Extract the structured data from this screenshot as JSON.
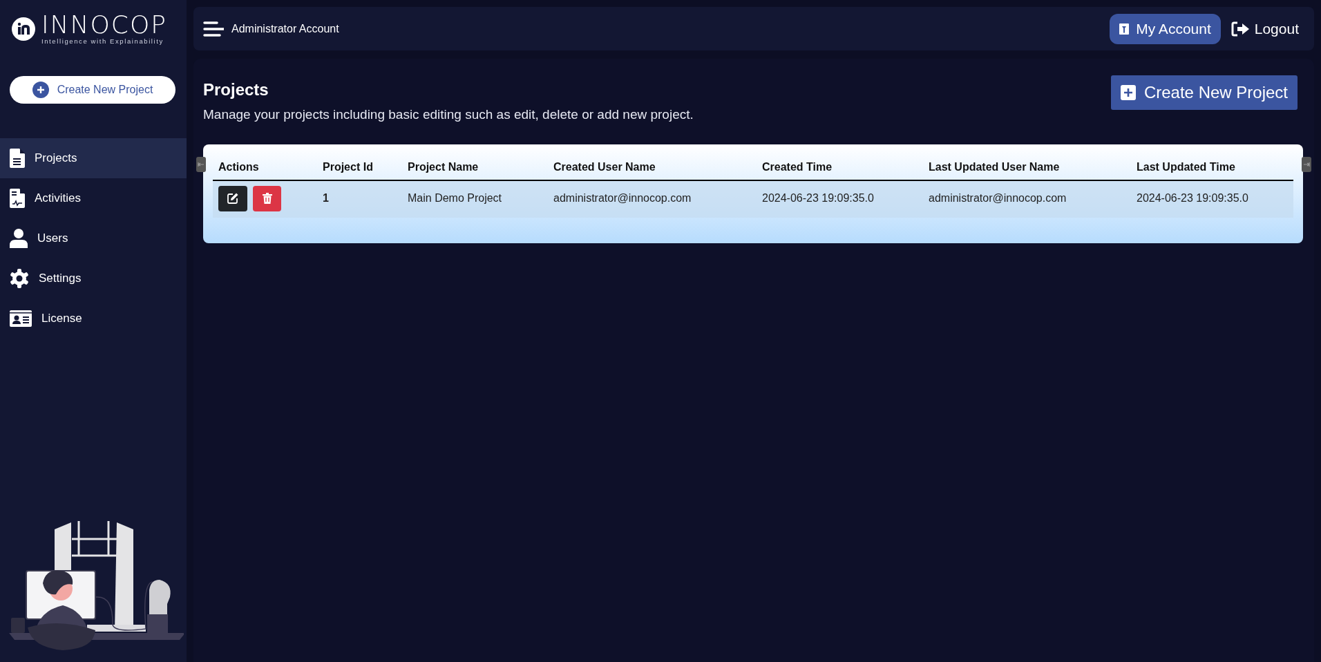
{
  "logo": {
    "name": "INNOCOP",
    "tagline": "Intelligence with Explainability"
  },
  "sidebar": {
    "create_button": "Create New Project",
    "items": [
      {
        "label": "Projects",
        "kind": "document",
        "selected": true
      },
      {
        "label": "Activities",
        "kind": "report",
        "selected": false
      },
      {
        "label": "Users",
        "kind": "person",
        "selected": false
      },
      {
        "label": "Settings",
        "kind": "settings",
        "selected": false
      },
      {
        "label": "License",
        "kind": "card",
        "selected": false
      }
    ]
  },
  "header": {
    "title": "Administrator Account",
    "account_button": "My Account",
    "logout": "Logout"
  },
  "page": {
    "title": "Projects",
    "subtitle": "Manage your projects including basic editing such as edit, delete or add new project.",
    "create_button": "Create New Project"
  },
  "table": {
    "columns": [
      "Actions",
      "Project Id",
      "Project Name",
      "Created User Name",
      "Created Time",
      "Last Updated User Name",
      "Last Updated Time"
    ],
    "rows": [
      {
        "project_id": "1",
        "project_name": "Main Demo Project",
        "created_user": "administrator@innocop.com",
        "created_time": "2024-06-23 19:09:35.0",
        "updated_user": "administrator@innocop.com",
        "updated_time": "2024-06-23 19:09:35.0"
      }
    ]
  }
}
